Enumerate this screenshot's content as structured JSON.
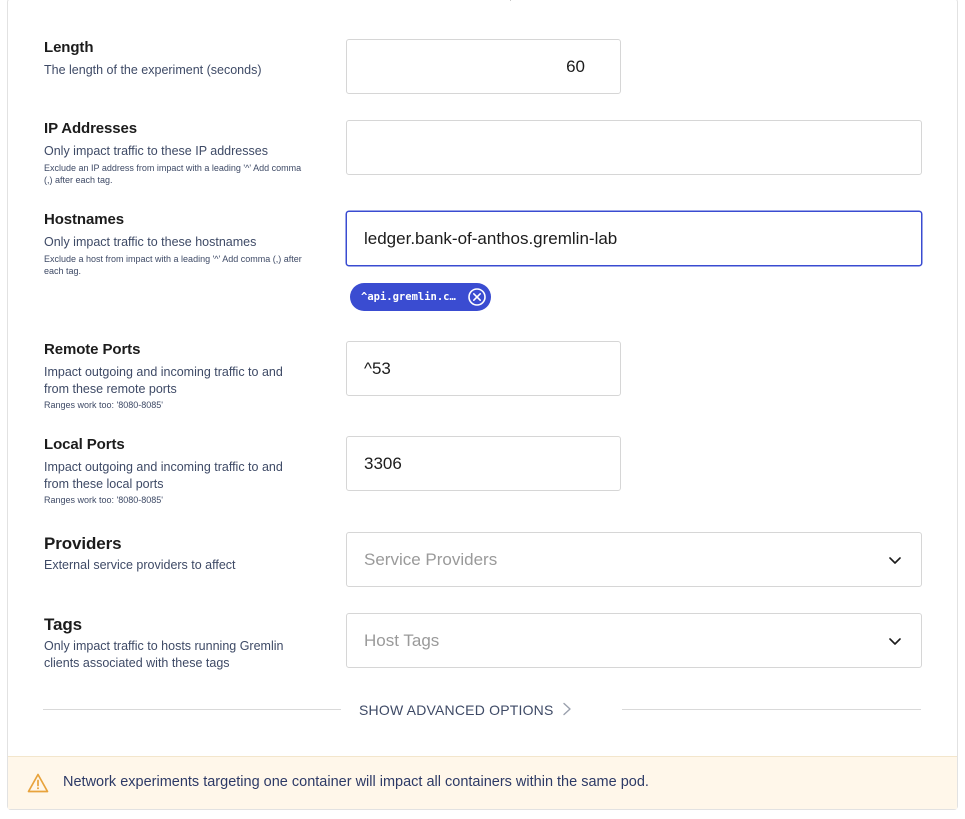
{
  "fields": {
    "length": {
      "title": "Length",
      "description": "The length of the experiment (seconds)",
      "value": "60"
    },
    "ip_addresses": {
      "title": "IP Addresses",
      "description": "Only impact traffic to these IP addresses",
      "hint": "Exclude an IP address from impact with a leading '^' Add comma (,) after each tag.",
      "value": ""
    },
    "hostnames": {
      "title": "Hostnames",
      "description": "Only impact traffic to these hostnames",
      "hint": "Exclude a host from impact with a leading '^' Add comma (,) after each tag.",
      "value": "ledger.bank-of-anthos.gremlin-lab",
      "tags": [
        "^api.gremlin.c…"
      ]
    },
    "remote_ports": {
      "title": "Remote Ports",
      "description": "Impact outgoing and incoming traffic to and from these remote ports",
      "hint": "Ranges work too: '8080-8085'",
      "value": "^53"
    },
    "local_ports": {
      "title": "Local Ports",
      "description": "Impact outgoing and incoming traffic to and from these local ports",
      "hint": "Ranges work too: '8080-8085'",
      "value": "3306"
    },
    "providers": {
      "title": "Providers",
      "description": "External service providers to affect",
      "placeholder": "Service Providers"
    },
    "tags": {
      "title": "Tags",
      "description": "Only impact traffic to hosts running Gremlin clients associated with these tags",
      "placeholder": "Host Tags"
    }
  },
  "advanced": {
    "label": "SHOW ADVANCED OPTIONS",
    "icon": "chevron-right-icon"
  },
  "alert": {
    "icon": "warning-icon",
    "text": "Network experiments targeting one container will impact all containers within the same pod."
  },
  "colors": {
    "accent": "#3a4cd1",
    "warning_bg": "#fff7ea",
    "warning_icon": "#e8a33c",
    "text_secondary": "#3e4a66"
  }
}
